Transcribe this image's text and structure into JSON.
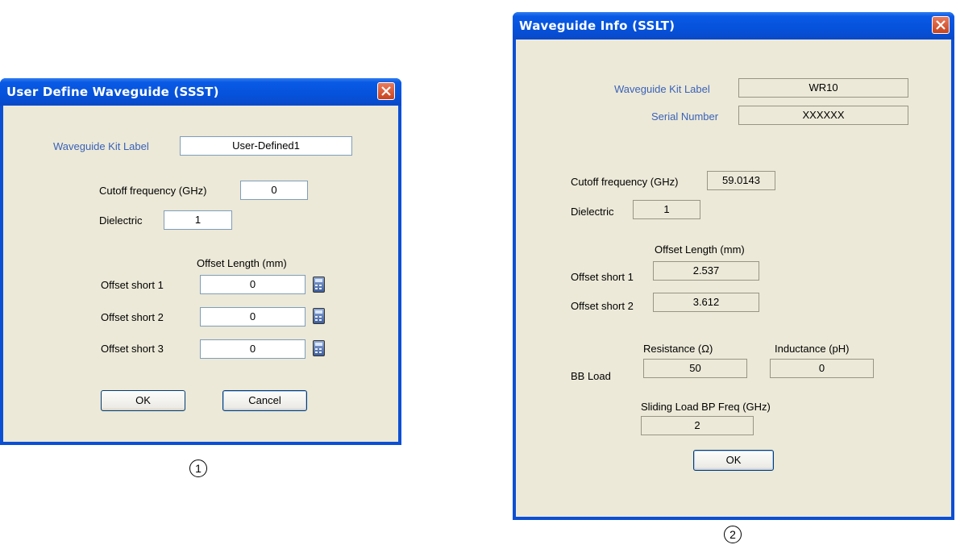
{
  "dialog1": {
    "title": "User Define Waveguide (SSST)",
    "kit_label_label": "Waveguide Kit Label",
    "kit_label_value": "User-Defined1",
    "cutoff_label": "Cutoff frequency (GHz)",
    "cutoff_value": "0",
    "dielectric_label": "Dielectric",
    "dielectric_value": "1",
    "offset_length_header": "Offset Length (mm)",
    "offsets": [
      {
        "label": "Offset short 1",
        "value": "0"
      },
      {
        "label": "Offset short 2",
        "value": "0"
      },
      {
        "label": "Offset short 3",
        "value": "0"
      }
    ],
    "ok_label": "OK",
    "cancel_label": "Cancel",
    "marker": "1"
  },
  "dialog2": {
    "title": "Waveguide Info (SSLT)",
    "kit_label_label": "Waveguide Kit Label",
    "kit_label_value": "WR10",
    "serial_label": "Serial Number",
    "serial_value": "XXXXXX",
    "cutoff_label": "Cutoff frequency (GHz)",
    "cutoff_value": "59.0143",
    "dielectric_label": "Dielectric",
    "dielectric_value": "1",
    "offset_length_header": "Offset Length (mm)",
    "offsets": [
      {
        "label": "Offset short 1",
        "value": "2.537"
      },
      {
        "label": "Offset short 2",
        "value": "3.612"
      }
    ],
    "bb_load_label": "BB Load",
    "resistance_label": "Resistance (Ω)",
    "resistance_value": "50",
    "inductance_label": "Inductance (pH)",
    "inductance_value": "0",
    "sliding_label": "Sliding Load BP Freq (GHz)",
    "sliding_value": "2",
    "ok_label": "OK",
    "marker": "2"
  },
  "colors": {
    "title_bar": "#0552db",
    "client_bg": "#ece9d8",
    "blue_label": "#3a62b8",
    "close_button": "#c8431e"
  },
  "icons": [
    "close-icon",
    "calculator-icon"
  ]
}
